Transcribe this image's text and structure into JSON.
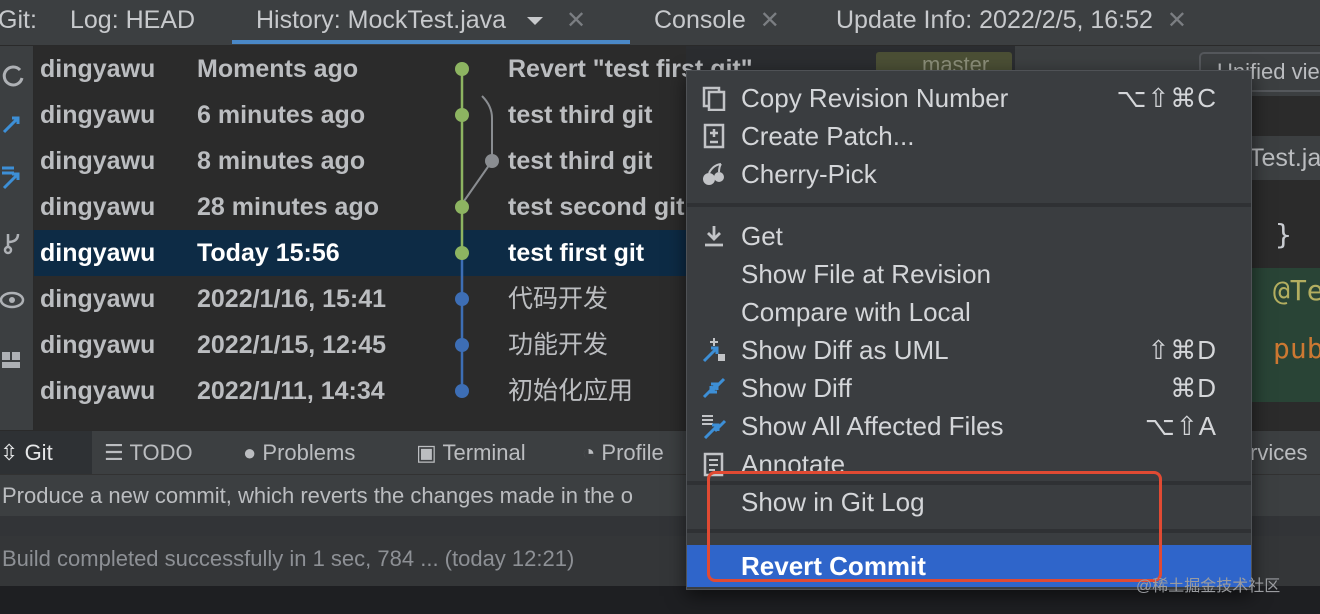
{
  "tabs": {
    "git_fragment": "Git:",
    "log": "Log: HEAD",
    "history": "History: MockTest.java",
    "console": "Console",
    "update": "Update Info: 2022/2/5, 16:52"
  },
  "commits": [
    {
      "author": "dingyawu",
      "date": "Moments ago",
      "message": "Revert \"test first git\""
    },
    {
      "author": "dingyawu",
      "date": "6 minutes ago",
      "message": "test third git"
    },
    {
      "author": "dingyawu",
      "date": "8 minutes ago",
      "message": "test third git"
    },
    {
      "author": "dingyawu",
      "date": "28 minutes ago",
      "message": "test second git"
    },
    {
      "author": "dingyawu",
      "date": "Today 15:56",
      "message": "test first git",
      "selected": true
    },
    {
      "author": "dingyawu",
      "date": "2022/1/16, 15:41",
      "message": "代码开发"
    },
    {
      "author": "dingyawu",
      "date": "2022/1/15, 12:45",
      "message": "功能开发"
    },
    {
      "author": "dingyawu",
      "date": "2022/1/11, 14:34",
      "message": "初始化应用"
    }
  ],
  "branch_label": "master",
  "right_panel": {
    "view_dropdown": "Unified vie",
    "file_tab": "Test.ja",
    "code_brace": "}",
    "code_annotation": "@Te",
    "code_keyword": "pub"
  },
  "context_menu": {
    "items": [
      {
        "label": "Copy Revision Number",
        "shortcut": "⌥⇧⌘C",
        "icon": "copy-icon"
      },
      {
        "label": "Create Patch...",
        "shortcut": "",
        "icon": "patch-icon"
      },
      {
        "label": "Cherry-Pick",
        "shortcut": "",
        "icon": "cherry-icon"
      },
      {
        "label": "Get",
        "shortcut": "",
        "icon": "download-icon"
      },
      {
        "label": "Show File at Revision",
        "shortcut": "",
        "icon": ""
      },
      {
        "label": "Compare with Local",
        "shortcut": "",
        "icon": ""
      },
      {
        "label": "Show Diff as UML",
        "shortcut": "⇧⌘D",
        "icon": "diff-uml-icon"
      },
      {
        "label": "Show Diff",
        "shortcut": "⌘D",
        "icon": "diff-icon"
      },
      {
        "label": "Show All Affected Files",
        "shortcut": "⌥⇧A",
        "icon": "affected-files-icon"
      },
      {
        "label": "Annotate",
        "shortcut": "",
        "icon": "annotate-icon"
      },
      {
        "label": "Show in Git Log",
        "shortcut": "",
        "icon": ""
      },
      {
        "label": "Revert Commit",
        "shortcut": "",
        "icon": "",
        "highlighted": true
      }
    ]
  },
  "bottom_tools": {
    "git": "Git",
    "todo": "TODO",
    "problems": "Problems",
    "terminal": "Terminal",
    "profiler": "Profile",
    "services": "rvices"
  },
  "status_hint": "Produce a new commit, which reverts the changes made in the o",
  "build_status": "Build completed successfully in 1 sec, 784 ... (today 12:21)",
  "watermark": "@稀土掘金技术社区",
  "colors": {
    "accent": "#4a88c7",
    "selection": "#0d2b45",
    "menu_highlight": "#2f65ca",
    "graph_green": "#8db461",
    "graph_blue": "#3d6eb5",
    "annotation_box": "#e04a33"
  }
}
